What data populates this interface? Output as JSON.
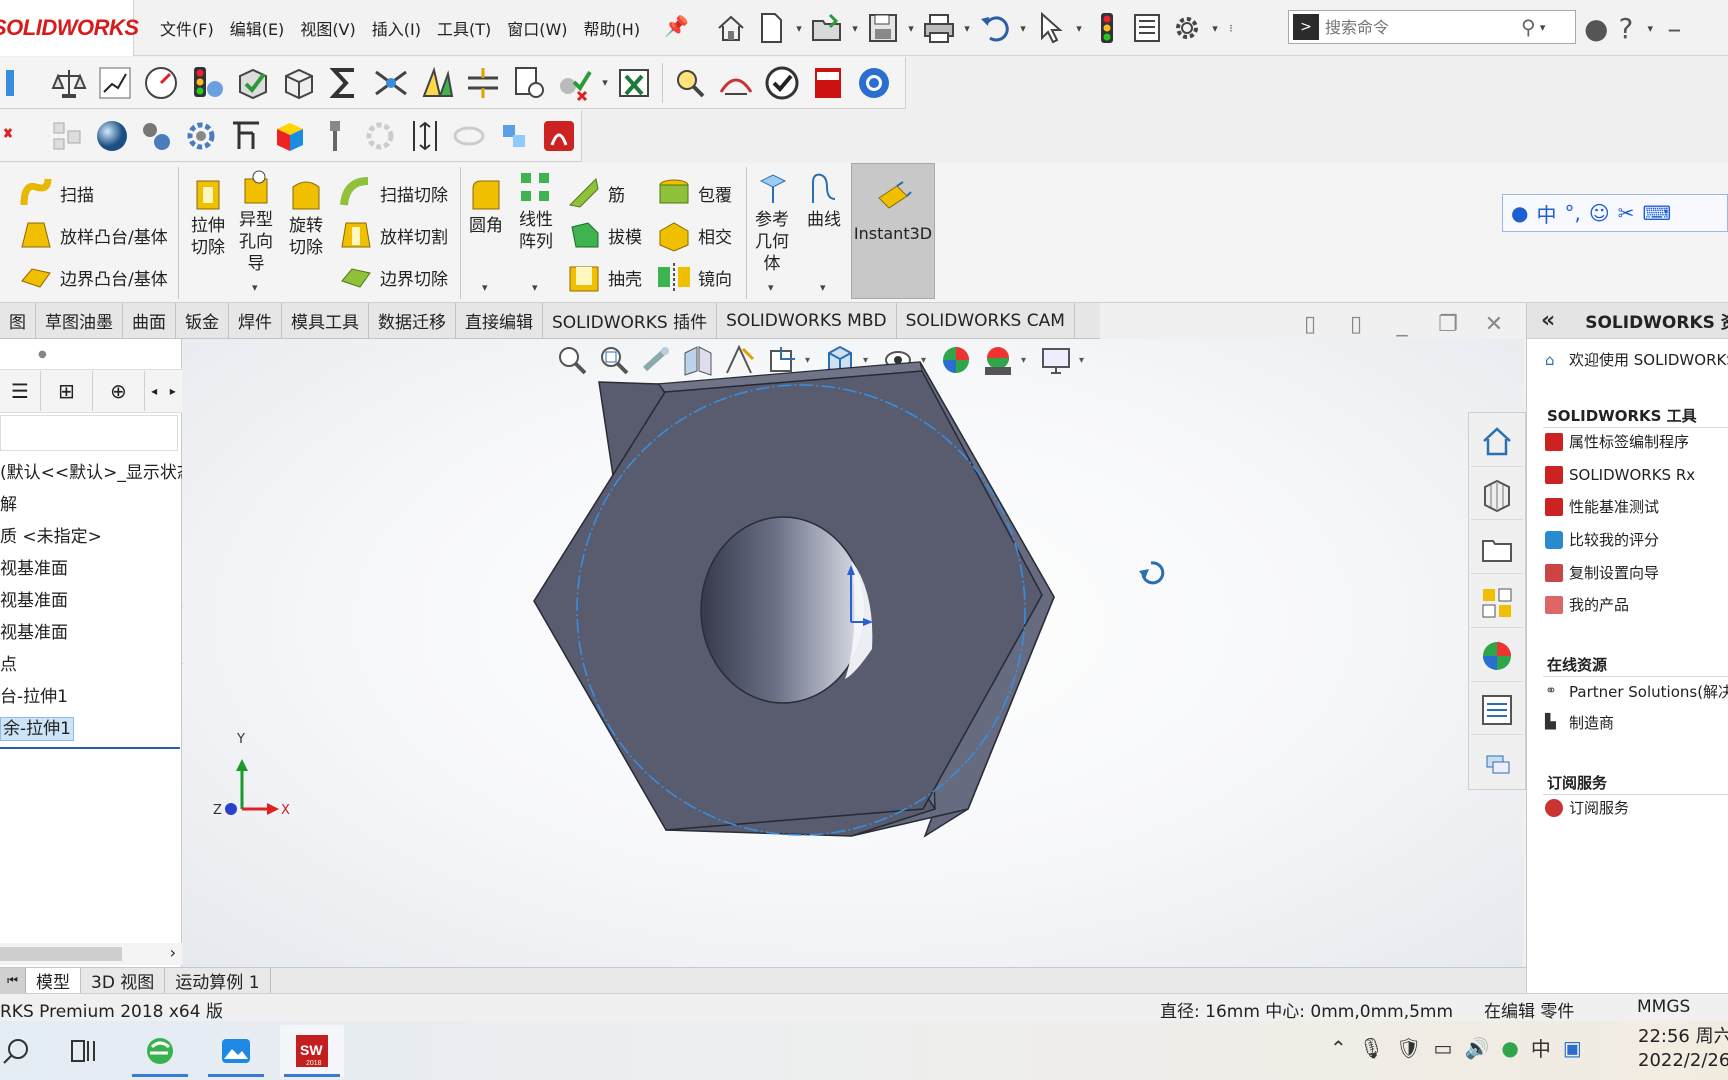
{
  "app": {
    "logo_text": "SOLIDWORKS"
  },
  "menu": {
    "items": [
      "文件(F)",
      "编辑(E)",
      "视图(V)",
      "插入(I)",
      "工具(T)",
      "窗口(W)",
      "帮助(H)"
    ]
  },
  "search": {
    "placeholder": "搜索命令"
  },
  "commands": {
    "sweep": "扫描",
    "loft_boss": "放样凸台/基体",
    "boundary_boss": "边界凸台/基体",
    "extruded_cut": "拉伸切除",
    "hole_wizard": "异型孔向导",
    "revolved_cut": "旋转切除",
    "swept_cut": "扫描切除",
    "lofted_cut": "放样切割",
    "boundary_cut": "边界切除",
    "fillet": "圆角",
    "linear_pattern": "线性阵列",
    "rib": "筋",
    "draft": "拔模",
    "shell": "抽壳",
    "wrap": "包覆",
    "intersect": "相交",
    "mirror": "镜向",
    "ref_geometry": "参考几何体",
    "curves": "曲线",
    "instant3d": "Instant3D"
  },
  "tabs": [
    "图",
    "草图油墨",
    "曲面",
    "钣金",
    "焊件",
    "模具工具",
    "数据迁移",
    "直接编辑",
    "SOLIDWORKS 插件",
    "SOLIDWORKS MBD",
    "SOLIDWORKS CAM"
  ],
  "feature_tree": {
    "items": [
      "(默认<<默认>_显示状态",
      "解",
      "质 <未指定>",
      "视基准面",
      "视基准面",
      "视基准面",
      "点",
      "台-拉伸1",
      "余-拉伸1"
    ],
    "selected_index": 8
  },
  "triad": {
    "x": "X",
    "y": "Y",
    "z": "Z"
  },
  "task_pane": {
    "title": "SOLIDWORKS 资源",
    "welcome": "欢迎使用 SOLIDWORKS",
    "tools_header": "SOLIDWORKS 工具",
    "tools": [
      "属性标签编制程序",
      "SOLIDWORKS Rx",
      "性能基准测试",
      "比较我的评分",
      "复制设置向导",
      "我的产品"
    ],
    "online_header": "在线资源",
    "online": [
      "Partner Solutions(解决方案)",
      "制造商"
    ],
    "subscription_header": "订阅服务",
    "subscription": [
      "订阅服务"
    ]
  },
  "bottom_tabs": [
    "模型",
    "3D 视图",
    "运动算例 1"
  ],
  "status": {
    "version": "RKS Premium 2018 x64 版",
    "measure": "直径: 16mm  中心: 0mm,0mm,5mm",
    "mode": "在编辑 零件",
    "units": "MMGS"
  },
  "taskbar": {
    "sw_badge": "SW",
    "sw_year": "2018"
  },
  "clock": {
    "time": "22:56 周六",
    "date": "2022/2/26"
  },
  "colors": {
    "accent": "#3a8dde",
    "brand_red": "#d71a1a",
    "model_face": "#5c6072",
    "model_side": "#6f7388",
    "selection": "#3a8dde"
  }
}
